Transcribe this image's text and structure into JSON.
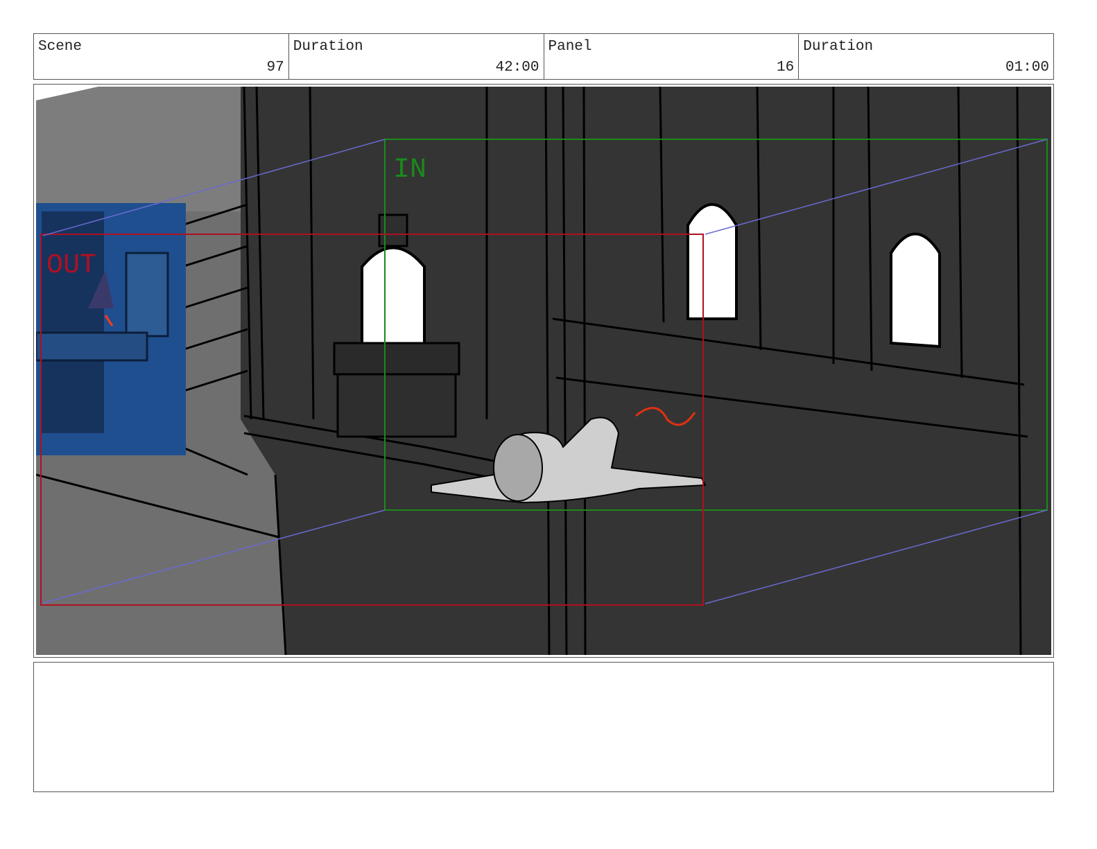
{
  "header": {
    "scene_label": "Scene",
    "scene_value": "97",
    "scene_duration_label": "Duration",
    "scene_duration_value": "42:00",
    "panel_label": "Panel",
    "panel_value": "16",
    "panel_duration_label": "Duration",
    "panel_duration_value": "01:00"
  },
  "frame": {
    "in_label": "IN",
    "out_label": "OUT",
    "colors": {
      "in": "#1a8a1a",
      "out": "#b01020",
      "arrow": "#6a6ad0",
      "wall": "#333333",
      "ground": "#777777",
      "inset": "#1f4f8f"
    }
  },
  "notes": {
    "text": ""
  }
}
